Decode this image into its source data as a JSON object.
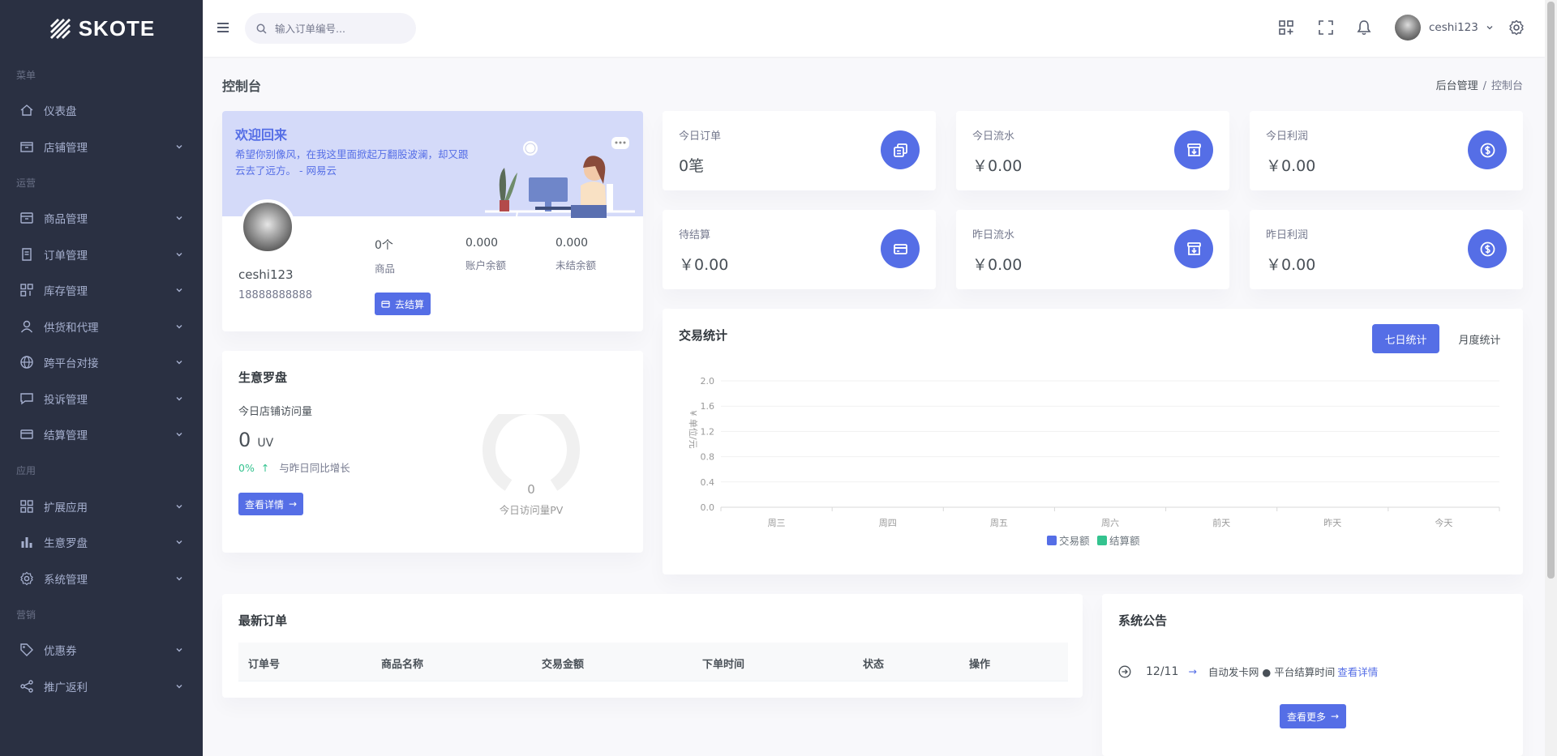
{
  "brand": {
    "name": "SKOTE"
  },
  "sidebar": {
    "sections": [
      {
        "title": "菜单",
        "items": [
          {
            "label": "仪表盘",
            "icon": "home-icon",
            "chevron": false
          },
          {
            "label": "店铺管理",
            "icon": "store-icon",
            "chevron": true
          }
        ]
      },
      {
        "title": "运营",
        "items": [
          {
            "label": "商品管理",
            "icon": "box-icon",
            "chevron": true
          },
          {
            "label": "订单管理",
            "icon": "receipt-icon",
            "chevron": true
          },
          {
            "label": "库存管理",
            "icon": "grid-icon",
            "chevron": true
          },
          {
            "label": "供货和代理",
            "icon": "user-icon",
            "chevron": true
          },
          {
            "label": "跨平台对接",
            "icon": "globe-icon",
            "chevron": true
          },
          {
            "label": "投诉管理",
            "icon": "chat-icon",
            "chevron": true
          },
          {
            "label": "结算管理",
            "icon": "card-icon",
            "chevron": true
          }
        ]
      },
      {
        "title": "应用",
        "items": [
          {
            "label": "扩展应用",
            "icon": "apps-icon",
            "chevron": true
          },
          {
            "label": "生意罗盘",
            "icon": "bar-chart-icon",
            "chevron": true
          },
          {
            "label": "系统管理",
            "icon": "gear-icon",
            "chevron": true
          }
        ]
      },
      {
        "title": "营销",
        "items": [
          {
            "label": "优惠券",
            "icon": "tag-icon",
            "chevron": true
          },
          {
            "label": "推广返利",
            "icon": "share-icon",
            "chevron": true
          }
        ]
      }
    ]
  },
  "topbar": {
    "search_placeholder": "输入订单编号...",
    "username": "ceshi123"
  },
  "page": {
    "title": "控制台",
    "breadcrumb": [
      "后台管理",
      "控制台"
    ]
  },
  "welcome": {
    "title": "欢迎回来",
    "quote": "希望你别像风，在我这里面掀起万翻股波澜，却又跟云去了远方。 - 网易云",
    "name": "ceshi123",
    "phone": "18888888888",
    "stats": [
      {
        "value": "0个",
        "label": "商品"
      },
      {
        "value": "0.000",
        "label": "账户余额"
      },
      {
        "value": "0.000",
        "label": "未结余额"
      }
    ],
    "settle_button": "去结算"
  },
  "mini_stats": [
    {
      "title": "今日订单",
      "value": "0笔",
      "icon": "copy-icon"
    },
    {
      "title": "今日流水",
      "value": "￥0.00",
      "icon": "archive-in-icon"
    },
    {
      "title": "今日利润",
      "value": "￥0.00",
      "icon": "dollar-circle-icon"
    },
    {
      "title": "待结算",
      "value": "￥0.00",
      "icon": "credit-card-icon"
    },
    {
      "title": "昨日流水",
      "value": "￥0.00",
      "icon": "archive-in-icon"
    },
    {
      "title": "昨日利润",
      "value": "￥0.00",
      "icon": "dollar-circle-icon"
    }
  ],
  "compass": {
    "title": "生意罗盘",
    "visit_label": "今日店铺访问量",
    "visit_value": "0",
    "visit_unit": "UV",
    "growth_value": "0%",
    "growth_label": "与昨日同比增长",
    "detail_button": "查看详情",
    "gauge_value": "0",
    "gauge_label": "今日访问量PV",
    "gauge_fraction": 0
  },
  "trade": {
    "title": "交易统计",
    "tabs": [
      "七日统计",
      "月度统计"
    ],
    "active_tab": 0
  },
  "chart_data": {
    "type": "bar",
    "categories": [
      "周三",
      "周四",
      "周五",
      "周六",
      "前天",
      "昨天",
      "今天"
    ],
    "ylabel": "¥ 单位/元",
    "ylim": [
      0,
      2.0
    ],
    "yticks": [
      "0.0",
      "0.4",
      "0.8",
      "1.2",
      "1.6",
      "2.0"
    ],
    "series": [
      {
        "name": "交易额",
        "values": [
          0,
          0,
          0,
          0,
          0,
          0,
          0
        ],
        "color": "#556ee6"
      },
      {
        "name": "结算额",
        "values": [
          0,
          0,
          0,
          0,
          0,
          0,
          0
        ],
        "color": "#34c38f"
      }
    ],
    "grid": true,
    "legend": "bottom"
  },
  "orders": {
    "title": "最新订单",
    "columns": [
      "订单号",
      "商品名称",
      "交易金额",
      "下单时间",
      "状态",
      "操作"
    ],
    "rows": []
  },
  "announcements": {
    "title": "系统公告",
    "items": [
      {
        "date": "12/11",
        "text": "自动发卡网 ● 平台结算时间",
        "link": "查看详情"
      }
    ],
    "more_button": "查看更多"
  },
  "colors": {
    "primary": "#556ee6",
    "success": "#34c38f",
    "sidebar_bg": "#2a3042",
    "sidebar_text": "#a6b0cf"
  }
}
